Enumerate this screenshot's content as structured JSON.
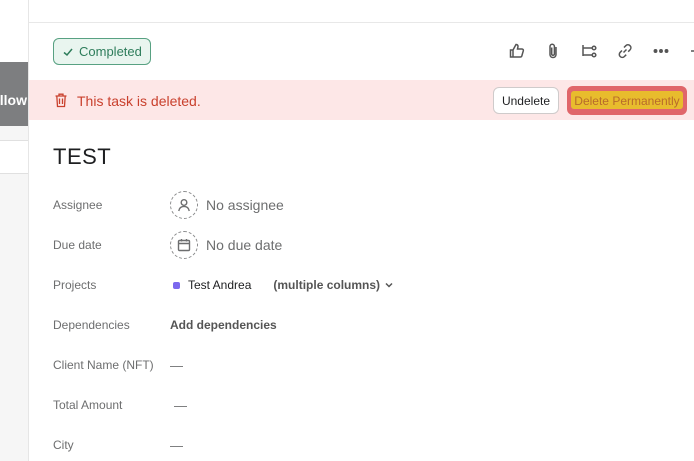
{
  "background_page": {
    "partial_text": "ollow"
  },
  "header": {
    "completed_label": "Completed",
    "toolbar_icons": [
      "thumbs-up-icon",
      "paperclip-icon",
      "subtask-icon",
      "link-icon",
      "more-icon",
      "arrow-right-icon"
    ]
  },
  "deleted_banner": {
    "message": "This task is deleted.",
    "undelete_label": "Undelete",
    "delete_permanently_label": "Delete Permanently",
    "background_color": "#fde7e7",
    "message_color": "#c9402d"
  },
  "task": {
    "title": "TEST",
    "fields": {
      "assignee": {
        "label": "Assignee",
        "value": "No assignee"
      },
      "due_date": {
        "label": "Due date",
        "value": "No due date"
      },
      "projects": {
        "label": "Projects",
        "project_name": "Test Andrea",
        "section": "(multiple columns)",
        "project_color": "#7b68ee"
      },
      "dependencies": {
        "label": "Dependencies",
        "value": "Add dependencies"
      },
      "client_name": {
        "label": "Client Name (NFT)",
        "value": "—"
      },
      "total_amount": {
        "label": "Total Amount",
        "value": "—"
      },
      "city": {
        "label": "City",
        "value": "—"
      }
    }
  },
  "colors": {
    "completed_green": "#58a182",
    "delete_red": "#e0666a",
    "highlight_yellow": "#e8c12a"
  }
}
